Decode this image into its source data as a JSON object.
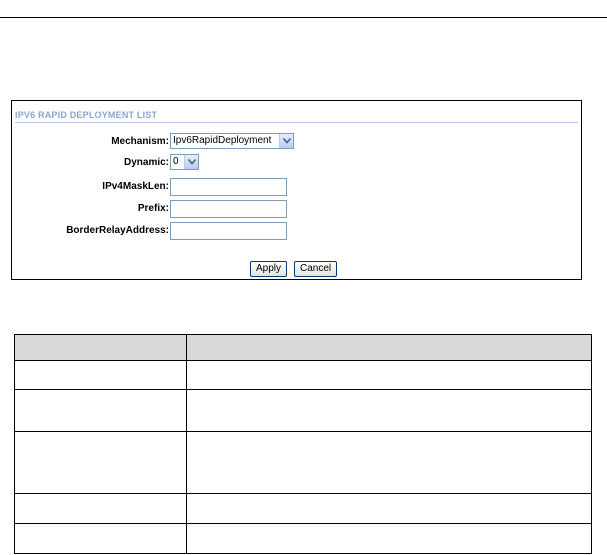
{
  "panel": {
    "title": "IPV6 RAPID DEPLOYMENT LIST"
  },
  "form": {
    "mechanism": {
      "label": "Mechanism:",
      "value": "Ipv6RapidDeployment",
      "icon": "chevron-down-icon"
    },
    "dynamic": {
      "label": "Dynamic:",
      "value": "0",
      "icon": "chevron-down-icon"
    },
    "ipv4_mask_len": {
      "label": "IPv4MaskLen:",
      "value": ""
    },
    "prefix": {
      "label": "Prefix:",
      "value": ""
    },
    "border_relay_address": {
      "label": "BorderRelayAddress:",
      "value": ""
    }
  },
  "buttons": {
    "apply": "Apply",
    "cancel": "Cancel"
  },
  "colors": {
    "panel_title": "#8aa6d0",
    "table_header_bg": "#d9d9d9",
    "input_border": "#7f9db9"
  },
  "table": {
    "headers": [
      "",
      ""
    ],
    "rows": [
      [
        "",
        ""
      ],
      [
        "",
        ""
      ],
      [
        "",
        ""
      ],
      [
        "",
        ""
      ],
      [
        "",
        ""
      ]
    ]
  }
}
